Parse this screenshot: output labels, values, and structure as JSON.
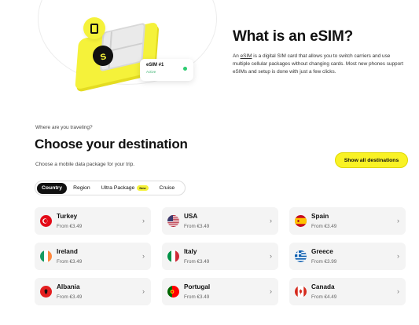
{
  "hero": {
    "title": "What is an eSIM?",
    "text_before": "An ",
    "text_link": "eSIM",
    "text_after": " is a digital SIM card that allows you to switch carriers and use multiple cellular packages without changing cards. Most new phones support eSIMs and setup is done with just a few clicks.",
    "card_title": "eSIM #1",
    "card_subtitle": "Active",
    "sim_logo": "s"
  },
  "destination": {
    "eyebrow": "Where are you traveling?",
    "title": "Choose your destination",
    "subtitle": "Choose a mobile data package for your trip.",
    "show_all_label": "Show all destinations",
    "tabs": [
      {
        "label": "Country",
        "active": true
      },
      {
        "label": "Region",
        "active": false
      },
      {
        "label": "Ultra Package",
        "badge": "New",
        "active": false
      },
      {
        "label": "Cruise",
        "active": false
      }
    ],
    "countries": [
      {
        "name": "Turkey",
        "price": "From €3.49",
        "flag": "flag-turkey-icon"
      },
      {
        "name": "USA",
        "price": "From €3.49",
        "flag": "flag-usa-icon"
      },
      {
        "name": "Spain",
        "price": "From €3.49",
        "flag": "flag-spain-icon"
      },
      {
        "name": "Ireland",
        "price": "From €3.49",
        "flag": "flag-ireland-icon"
      },
      {
        "name": "Italy",
        "price": "From €3.49",
        "flag": "flag-italy-icon"
      },
      {
        "name": "Greece",
        "price": "From €3.99",
        "flag": "flag-greece-icon"
      },
      {
        "name": "Albania",
        "price": "From €3.49",
        "flag": "flag-albania-icon"
      },
      {
        "name": "Portugal",
        "price": "From €3.49",
        "flag": "flag-portugal-icon"
      },
      {
        "name": "Canada",
        "price": "From €4.49",
        "flag": "flag-canada-icon"
      }
    ]
  },
  "colors": {
    "accent": "#f9f225",
    "card_bg": "#f4f4f4",
    "active_tab": "#111111"
  }
}
